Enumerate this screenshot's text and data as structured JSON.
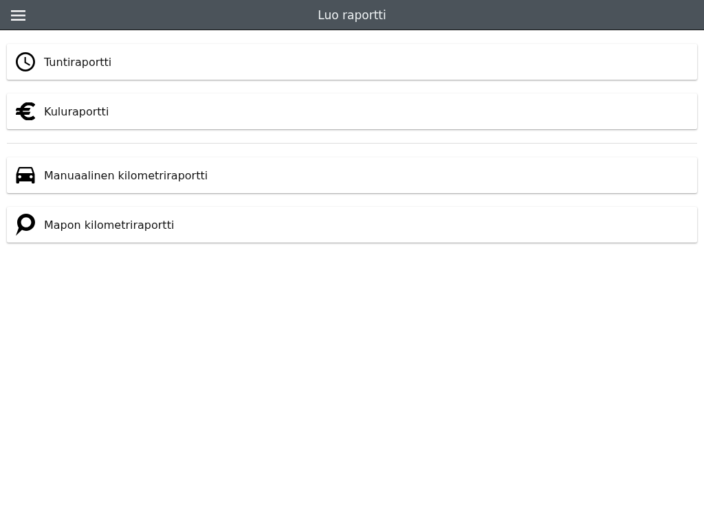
{
  "header": {
    "title": "Luo raportti"
  },
  "groups": [
    {
      "items": [
        {
          "kind": "clock",
          "label": "Tuntiraportti"
        },
        {
          "kind": "euro",
          "label": "Kuluraportti"
        }
      ]
    },
    {
      "items": [
        {
          "kind": "car",
          "label": "Manuaalinen kilometriraportti"
        },
        {
          "kind": "pin",
          "label": "Mapon kilometriraportti"
        }
      ]
    }
  ]
}
